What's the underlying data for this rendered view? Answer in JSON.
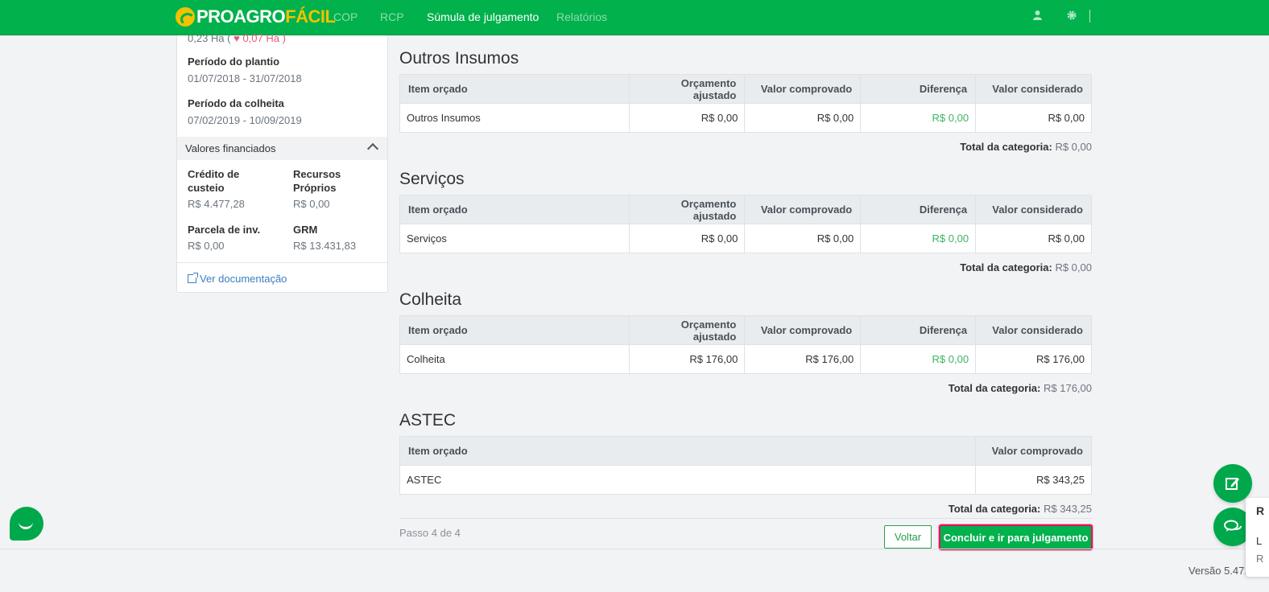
{
  "navbar": {
    "logo_part1": "PROAGRO",
    "logo_part2": "FÁCIL",
    "items": [
      {
        "label": "COP"
      },
      {
        "label": "RCP"
      },
      {
        "label": "Súmula de julgamento"
      },
      {
        "label": "Relatórios"
      }
    ],
    "user_icon": "user-icon",
    "settings_icon": "gear-icon"
  },
  "sidebar": {
    "area_value": "0,23 Ha (",
    "area_loss": "0,07 Ha",
    "area_close": ")",
    "planting_label": "Período do plantio",
    "planting_value": "01/07/2018 - 31/07/2018",
    "harvest_label": "Período da colheita",
    "harvest_value": "07/02/2019 - 10/09/2019",
    "financed_title": "Valores financiados",
    "credit_label": "Crédito de custeio",
    "credit_value": "R$ 4.477,28",
    "own_label": "Recursos Próprios",
    "own_value": "R$ 0,00",
    "inv_label": "Parcela de inv.",
    "inv_value": "R$ 0,00",
    "grm_label": "GRM",
    "grm_value": "R$ 13.431,83",
    "doc_link": "Ver documentação"
  },
  "headers": {
    "item": "Item orçado",
    "adjusted": "Orçamento ajustado",
    "proven": "Valor comprovado",
    "difference": "Diferença",
    "considered": "Valor considerado",
    "total_label": "Total da categoria:"
  },
  "sections": [
    {
      "title": "Outros Insumos",
      "item": "Outros Insumos",
      "adjusted": "R$ 0,00",
      "proven": "R$ 0,00",
      "difference": "R$ 0,00",
      "considered": "R$ 0,00",
      "total": "R$ 0,00"
    },
    {
      "title": "Serviços",
      "item": "Serviços",
      "adjusted": "R$ 0,00",
      "proven": "R$ 0,00",
      "difference": "R$ 0,00",
      "considered": "R$ 0,00",
      "total": "R$ 0,00"
    },
    {
      "title": "Colheita",
      "item": "Colheita",
      "adjusted": "R$ 176,00",
      "proven": "R$ 176,00",
      "difference": "R$ 0,00",
      "considered": "R$ 176,00",
      "total": "R$ 176,00"
    }
  ],
  "astec": {
    "title": "ASTEC",
    "item": "ASTEC",
    "proven": "R$ 343,25",
    "total": "R$ 343,25"
  },
  "footer": {
    "step": "Passo 4 de 4",
    "back_label": "Voltar",
    "finish_label": "Concluir e ir para julgamento",
    "version": "Versão 5.47."
  },
  "side_popup": {
    "line1": "R",
    "line2": "L",
    "line3": "R"
  },
  "colors": {
    "brand": "#00b14c",
    "accent_yellow": "#f2c200",
    "positive": "#3cb563",
    "link": "#3a7fc1"
  }
}
